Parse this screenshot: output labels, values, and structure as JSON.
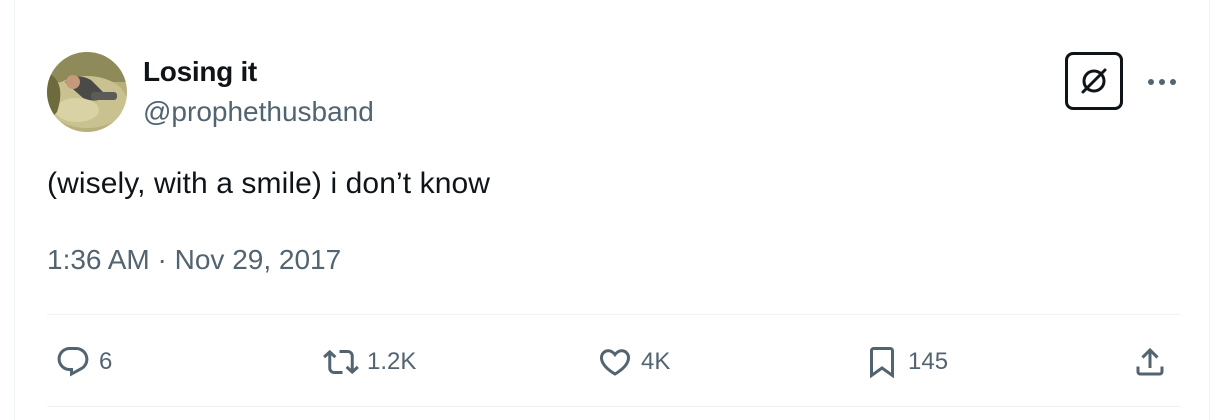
{
  "author": {
    "display_name": "Losing it",
    "handle": "@prophethusband",
    "avatar_icon": "avatar-photo"
  },
  "header_actions": {
    "grok_icon": "grok-icon",
    "more_icon": "more-horizontal-icon"
  },
  "tweet": {
    "text": "(wisely, with a smile) i don’t know",
    "time": "1:36 AM",
    "separator": "·",
    "date": "Nov 29, 2017"
  },
  "actions": {
    "replies": "6",
    "reposts": "1.2K",
    "likes": "4K",
    "bookmarks": "145"
  },
  "colors": {
    "text_primary": "#0f1419",
    "text_secondary": "#536471",
    "divider": "#eff3f4"
  }
}
